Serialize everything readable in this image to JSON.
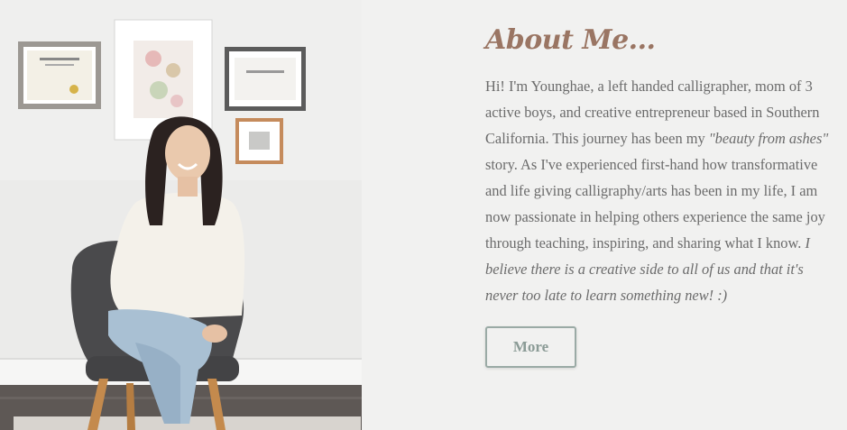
{
  "about": {
    "heading": "About Me...",
    "bio_part1": "Hi! I'm Younghae, a left handed calligrapher, mom of 3 active boys, and creative entrepreneur based in Southern California. This journey has been my ",
    "bio_quote": "\"beauty from ashes\"",
    "bio_part2": " story. As I've experienced first-hand how transformative and life giving calligraphy/arts has been in my life, I am now passionate in helping others experience the same joy through teaching, inspiring, and sharing what I know. ",
    "bio_belief": "I believe there is a creative side to all of us and that it's never too late to learn something new! :)",
    "more_label": "More"
  },
  "colors": {
    "heading": "#9a7563",
    "body_text": "#6b6b6b",
    "button_border": "#9aaaa5",
    "background": "#f1f1f0"
  }
}
